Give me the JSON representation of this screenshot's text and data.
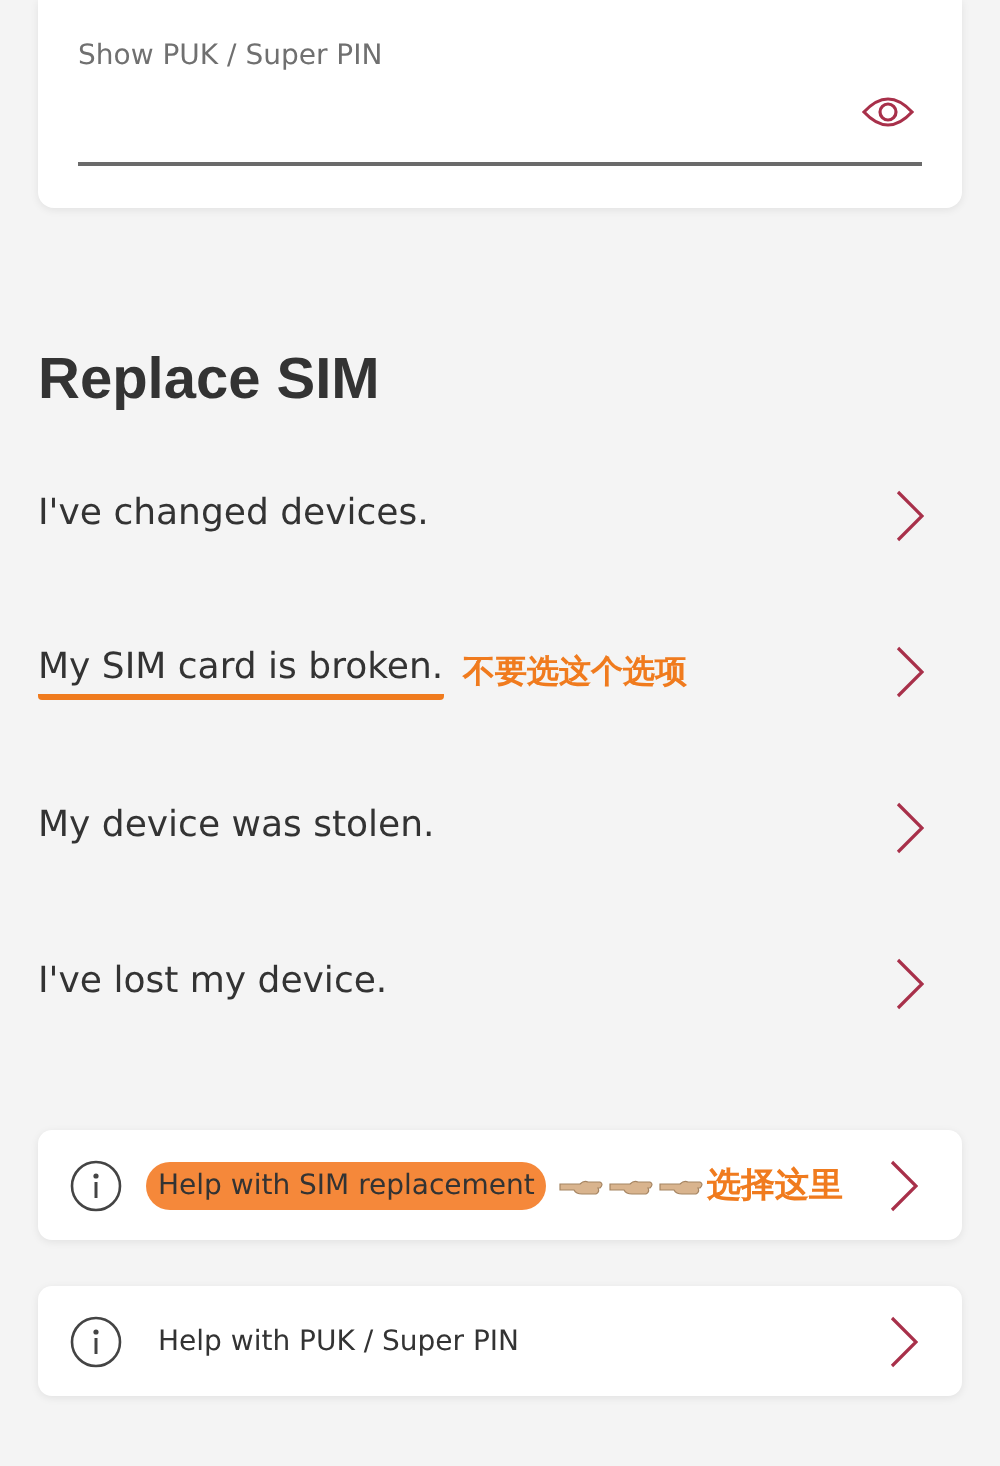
{
  "puk_field": {
    "label": "Show PUK / Super PIN"
  },
  "replace_sim": {
    "title": "Replace SIM",
    "options": [
      {
        "label": "I've changed devices.",
        "underlined": false
      },
      {
        "label": "My SIM card is broken.",
        "underlined": true,
        "note": "不要选这个选项"
      },
      {
        "label": "My device was stolen.",
        "underlined": false
      },
      {
        "label": "I've lost my device.",
        "underlined": false
      }
    ]
  },
  "help_links": [
    {
      "label": "Help with SIM replacement",
      "highlighted": true,
      "note": "选择这里"
    },
    {
      "label": "Help with PUK / Super PIN",
      "highlighted": false
    }
  ]
}
